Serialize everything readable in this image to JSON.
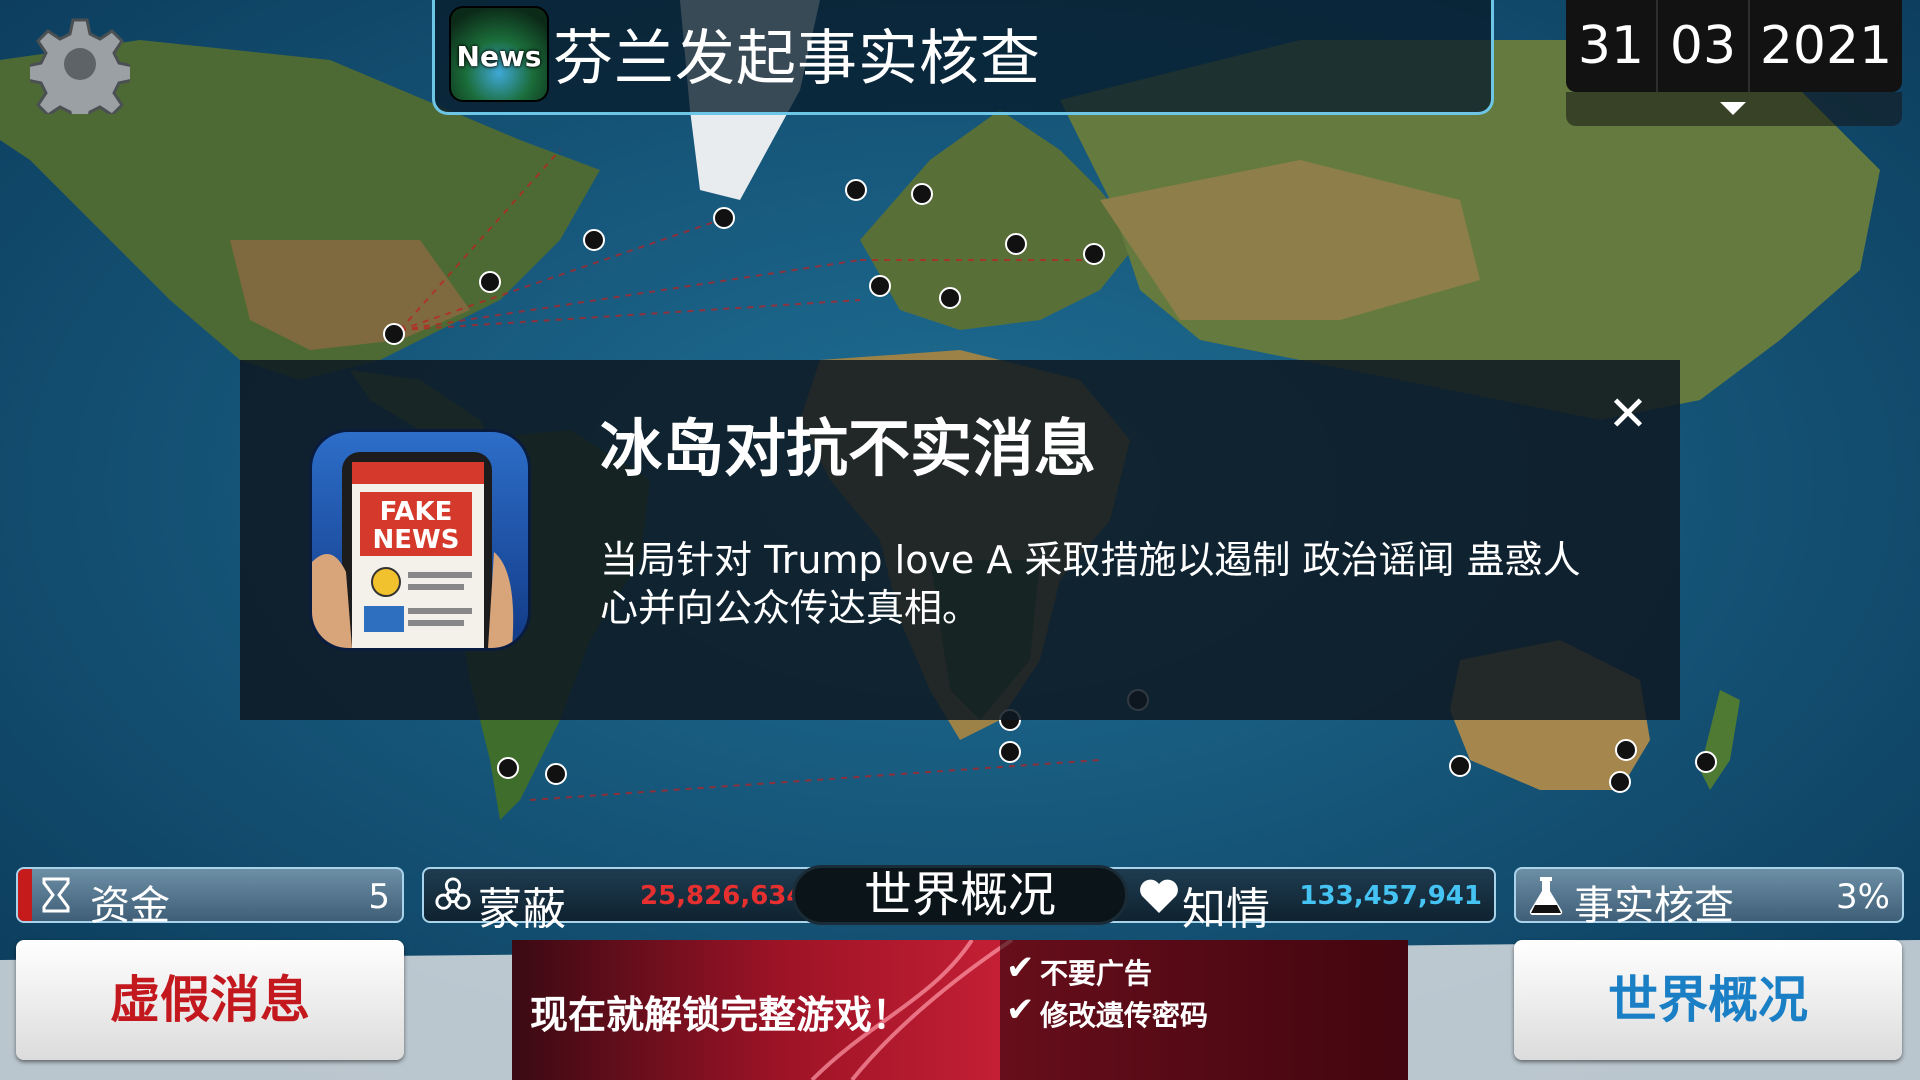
{
  "header": {
    "news_badge": "News",
    "news_ticker": "芬兰发起事实核查",
    "date": {
      "day": "31",
      "month": "03",
      "year": "2021"
    }
  },
  "popup": {
    "title": "冰岛对抗不实消息",
    "body": "当局针对 Trump love A 采取措施以遏制 政治谣闻 蛊惑人心并向公众传达真相。",
    "close": "✕",
    "icon_text_1": "FAKE",
    "icon_text_2": "NEWS"
  },
  "stats": {
    "funds_label": "资金",
    "funds_value": "5",
    "deceived_label": "蒙蔽",
    "deceived_value": "25,826,634",
    "world_label": "世界概况",
    "aware_label": "知情",
    "aware_value": "133,457,941",
    "factcheck_label": "事实核查",
    "factcheck_value": "3%"
  },
  "buttons": {
    "fake_news": "虚假消息",
    "world_overview": "世界概况"
  },
  "ad": {
    "headline": "现在就解锁完整游戏！",
    "item1": "不要广告",
    "item2": "修改遗传密码"
  },
  "colors": {
    "funds_accent": "#c61b1b",
    "deceived_value": "#e63030",
    "aware_value": "#45c4f4",
    "fake_news_button": "#c3181e",
    "world_button": "#1a7fc4"
  }
}
